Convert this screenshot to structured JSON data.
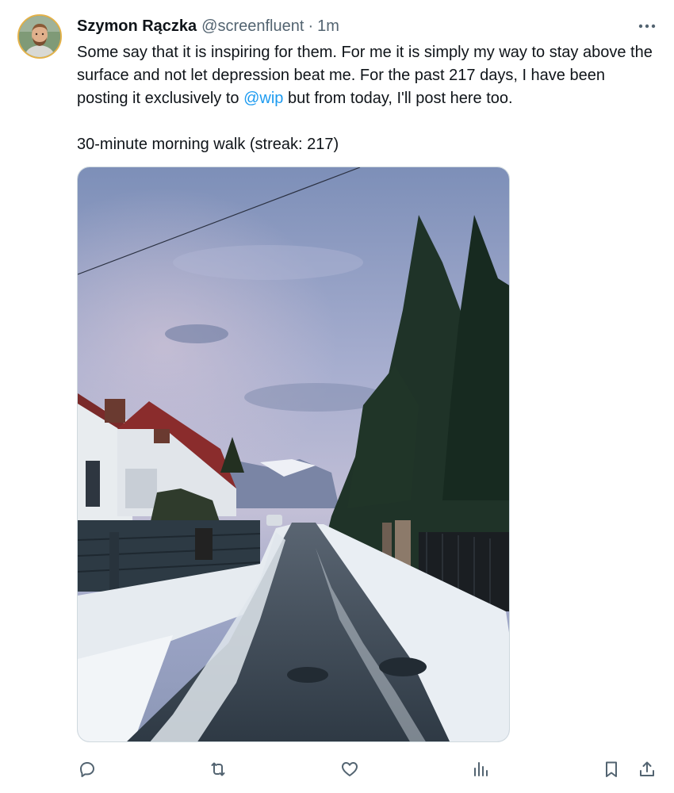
{
  "author": {
    "name": "Szymon Rączka",
    "handle": "@screenfluent",
    "separator": "·",
    "time": "1m"
  },
  "tweet": {
    "text_before_mention": "Some say that it is inspiring for them. For me it is simply my way to stay above the surface and not let depression beat me. For the past 217 days, I have been posting it exclusively to ",
    "mention": "@wip",
    "text_after_mention": " but from today, I'll post here too.",
    "line2": "30-minute morning walk (streak: 217)"
  },
  "icons": {
    "more": "more-horizontal-icon",
    "reply": "reply-icon",
    "retweet": "retweet-icon",
    "like": "like-icon",
    "views": "views-icon",
    "bookmark": "bookmark-icon",
    "share": "share-icon"
  },
  "colors": {
    "link": "#1d9bf0",
    "secondary_text": "#536471",
    "primary_text": "#0f1419",
    "avatar_ring": "#e4b24a"
  }
}
